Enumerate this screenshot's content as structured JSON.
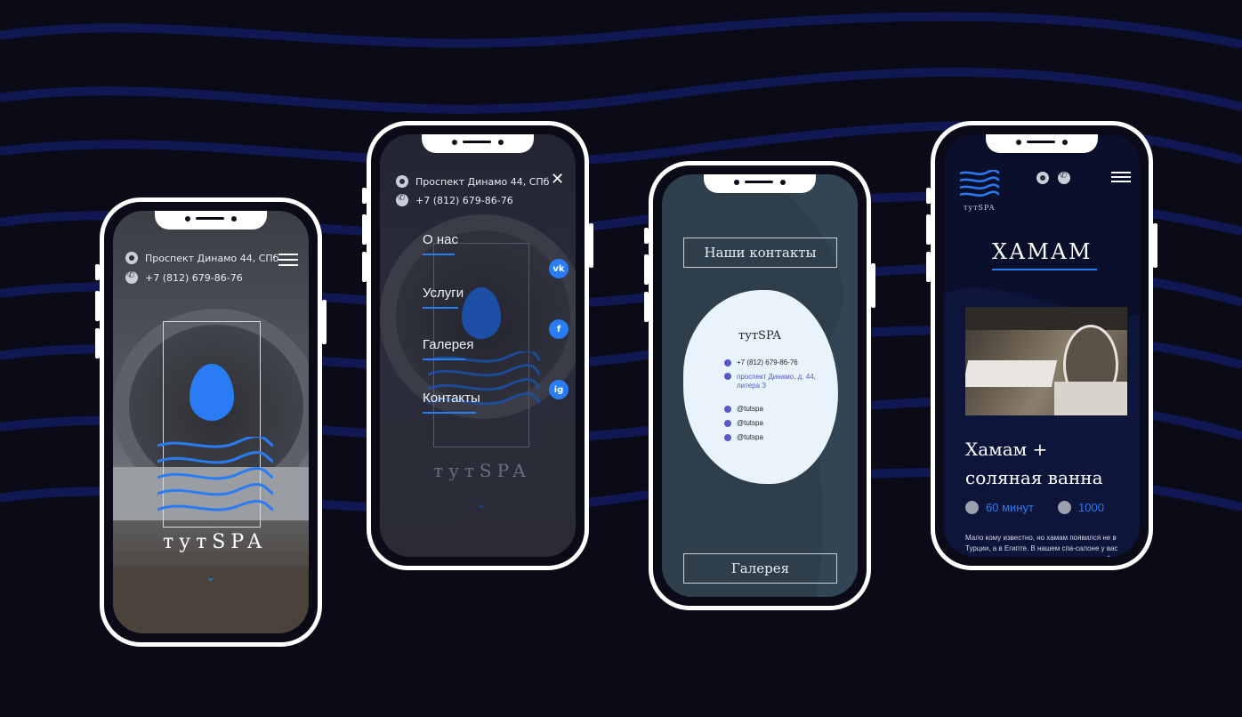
{
  "colors": {
    "background": "#0b0b18",
    "accent": "#2a7cf5",
    "frame": "#ffffff"
  },
  "screen1": {
    "address": "Проспект Динамо 44, СПб",
    "phone": "+7 (812) 679-86-76",
    "brand": "тутSPA",
    "icons": [
      "map-pin-icon",
      "phone-icon",
      "menu-icon",
      "chevron-down-icon"
    ]
  },
  "screen2": {
    "address": "Проспект Динамо 44, СПб",
    "phone": "+7 (812) 679-86-76",
    "menu": [
      "О нас",
      "Услуги",
      "Галерея",
      "Контакты"
    ],
    "brand": "тутSPA",
    "social_icons": [
      "vk-icon",
      "facebook-icon",
      "instagram-icon"
    ],
    "social_labels": [
      "vk",
      "f",
      "ig"
    ]
  },
  "screen3": {
    "contacts_button": "Наши контакты",
    "card_title": "тутSPA",
    "phone": "+7 (812) 679-86-76",
    "address": "проспект Динамо, д. 44, литера З",
    "socials": [
      "@tutspa",
      "@tutspa",
      "@tutspa"
    ],
    "gallery_button": "Галерея"
  },
  "screen4": {
    "brand": "тутSPA",
    "title": "ХАМАМ",
    "subtitle_line1": "Хамам +",
    "subtitle_line2": "соляная ванна",
    "duration": "60 минут",
    "price": "1000",
    "paragraph": "Мало кому известно, но хамам появился не в Турции, а в Египте. В нашем спа-салоне у вас есть возможность насладиться программой именно от"
  }
}
